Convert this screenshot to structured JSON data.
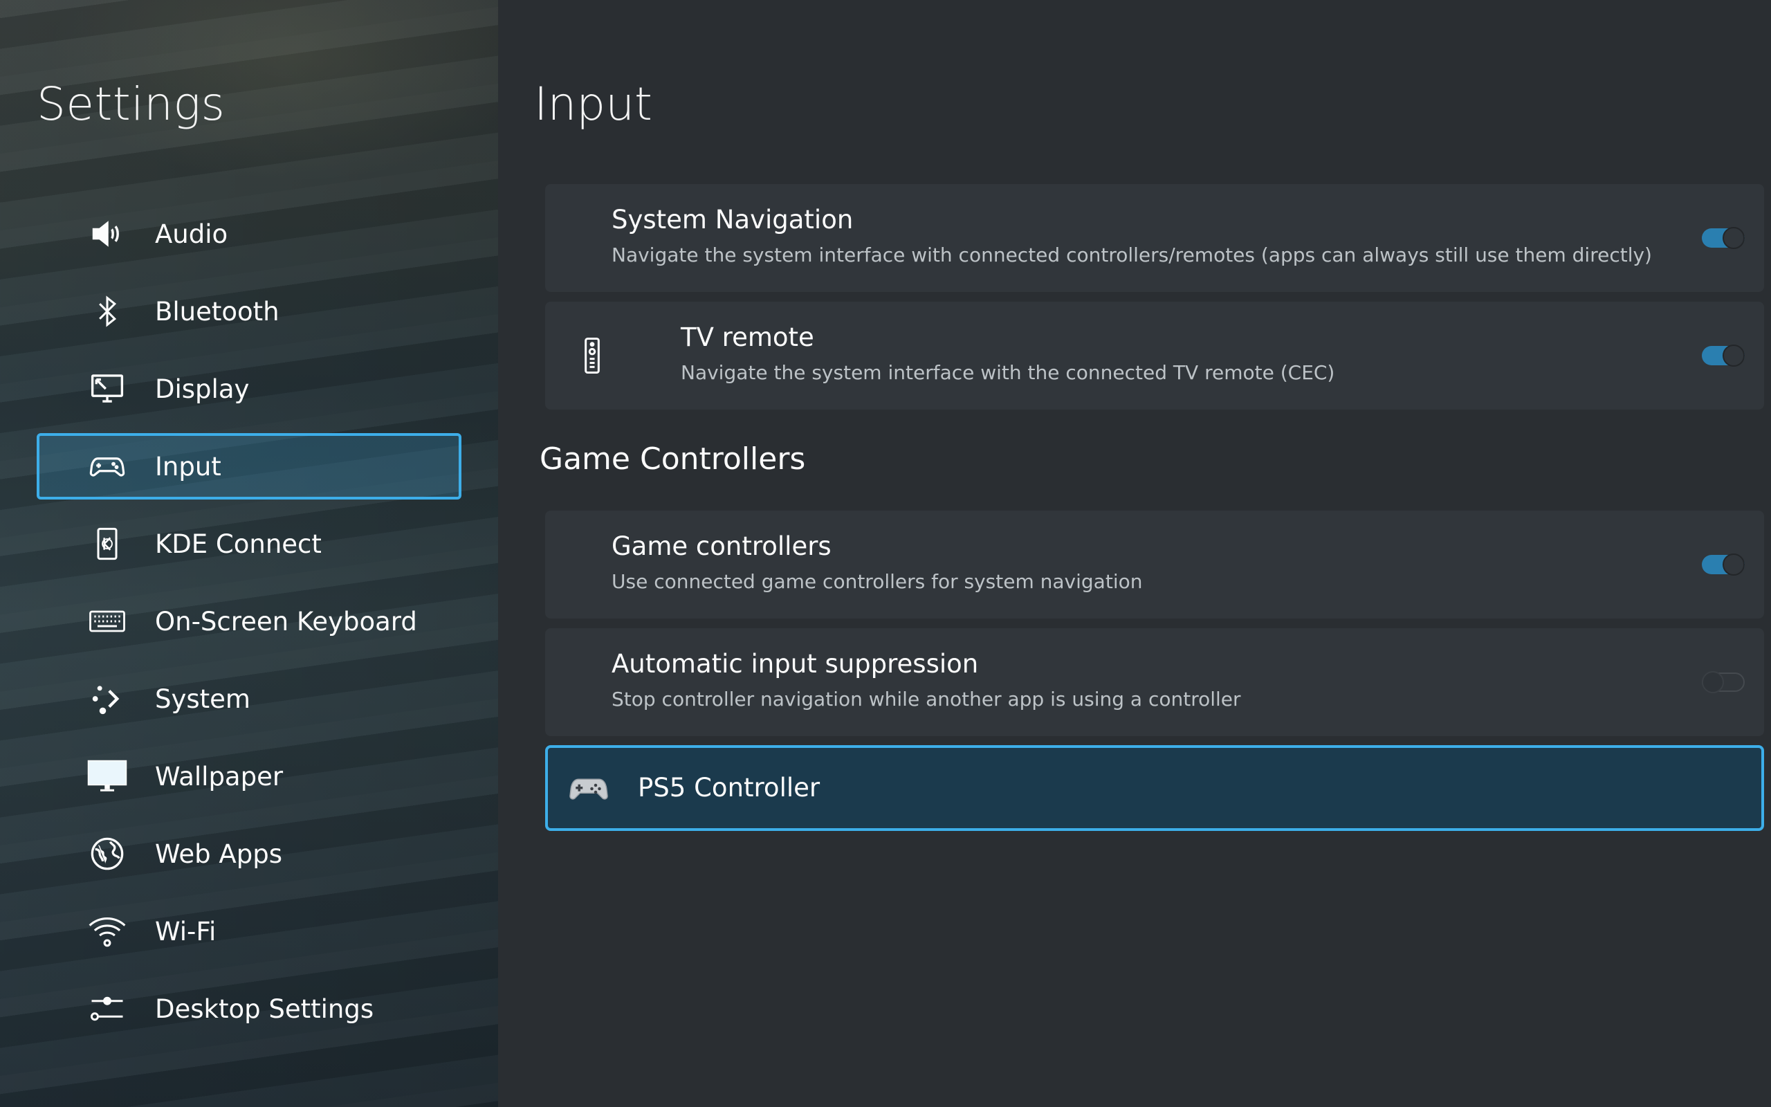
{
  "sidebar": {
    "title": "Settings",
    "items": [
      {
        "label": "Audio",
        "icon": "speaker-icon"
      },
      {
        "label": "Bluetooth",
        "icon": "bluetooth-icon"
      },
      {
        "label": "Display",
        "icon": "display-icon"
      },
      {
        "label": "Input",
        "icon": "gamepad-icon",
        "active": true
      },
      {
        "label": "KDE Connect",
        "icon": "kde-connect-icon"
      },
      {
        "label": "On-Screen Keyboard",
        "icon": "keyboard-icon"
      },
      {
        "label": "System",
        "icon": "system-icon"
      },
      {
        "label": "Wallpaper",
        "icon": "wallpaper-icon"
      },
      {
        "label": "Web Apps",
        "icon": "globe-icon"
      },
      {
        "label": "Wi-Fi",
        "icon": "wifi-icon"
      },
      {
        "label": "Desktop Settings",
        "icon": "sliders-icon"
      }
    ]
  },
  "main": {
    "title": "Input",
    "system_navigation": {
      "title": "System Navigation",
      "description": "Navigate the system interface with connected controllers/remotes (apps can always still use them directly)",
      "enabled": true
    },
    "tv_remote": {
      "title": "TV remote",
      "description": "Navigate the system interface with the connected TV remote (CEC)",
      "icon": "remote-icon",
      "enabled": true
    },
    "game_controllers_section": "Game Controllers",
    "game_controllers": {
      "title": "Game controllers",
      "description": "Use connected game controllers for system navigation",
      "enabled": true
    },
    "input_suppression": {
      "title": "Automatic input suppression",
      "description": "Stop controller navigation while another app is using a controller",
      "enabled": false
    },
    "device": {
      "title": "PS5 Controller",
      "icon": "gamepad-device-icon"
    }
  }
}
